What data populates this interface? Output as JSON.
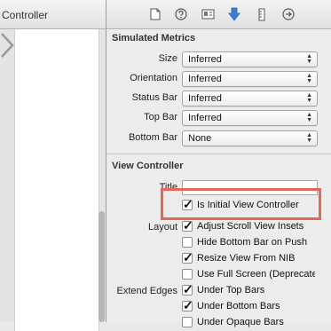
{
  "editor": {
    "left_title": "Controller"
  },
  "inspector_tabs": [
    {
      "name": "file-inspector",
      "icon": "file-icon"
    },
    {
      "name": "quick-help",
      "icon": "help-icon"
    },
    {
      "name": "identity-inspector",
      "icon": "id-card-icon"
    },
    {
      "name": "attributes-inspector",
      "icon": "down-arrow-icon",
      "selected": true
    },
    {
      "name": "size-inspector",
      "icon": "ruler-icon"
    },
    {
      "name": "connections-inspector",
      "icon": "arrow-circle-icon"
    }
  ],
  "simulated_metrics": {
    "header": "Simulated Metrics",
    "rows": [
      {
        "label": "Size",
        "value": "Inferred"
      },
      {
        "label": "Orientation",
        "value": "Inferred"
      },
      {
        "label": "Status Bar",
        "value": "Inferred"
      },
      {
        "label": "Top Bar",
        "value": "Inferred"
      },
      {
        "label": "Bottom Bar",
        "value": "None"
      }
    ]
  },
  "view_controller": {
    "header": "View Controller",
    "title_label": "Title",
    "title_value": "",
    "initial": {
      "label": "Is Initial View Controller",
      "checked": true
    },
    "layout_label": "Layout",
    "layout_options": [
      {
        "label": "Adjust Scroll View Insets",
        "checked": true
      },
      {
        "label": "Hide Bottom Bar on Push",
        "checked": false
      },
      {
        "label": "Resize View From NIB",
        "checked": true
      },
      {
        "label": "Use Full Screen (Deprecated)",
        "checked": false
      }
    ],
    "extend_edges_label": "Extend Edges",
    "extend_edges_options": [
      {
        "label": "Under Top Bars",
        "checked": true
      },
      {
        "label": "Under Bottom Bars",
        "checked": true
      },
      {
        "label": "Under Opaque Bars",
        "checked": false
      }
    ]
  },
  "colors": {
    "highlight": "#e8655a",
    "selected_tab": "#3b7ddd"
  }
}
